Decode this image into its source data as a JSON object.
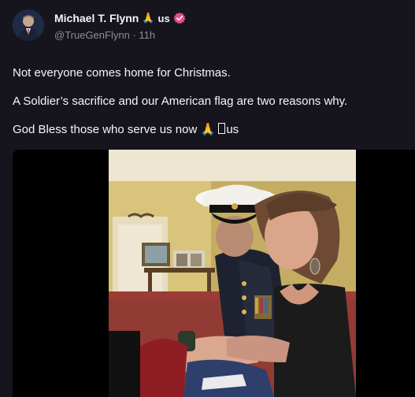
{
  "post": {
    "author": {
      "display_name": "Michael T. Flynn",
      "name_emoji": "🙏",
      "name_flag": "us",
      "handle": "@TrueGenFlynn",
      "separator": "·",
      "time": "11h",
      "verified_icon": "verified-badge-icon",
      "verified_color": "#e94a8b"
    },
    "text": {
      "line1": "Not everyone comes home for Christmas.",
      "line2": "A Soldier’s sacrifice and our American flag are two reasons why.",
      "line3_prefix": "God Bless those who serve us now",
      "line3_emoji": "🙏",
      "line3_suffix": "us"
    },
    "media": {
      "type": "video"
    }
  }
}
